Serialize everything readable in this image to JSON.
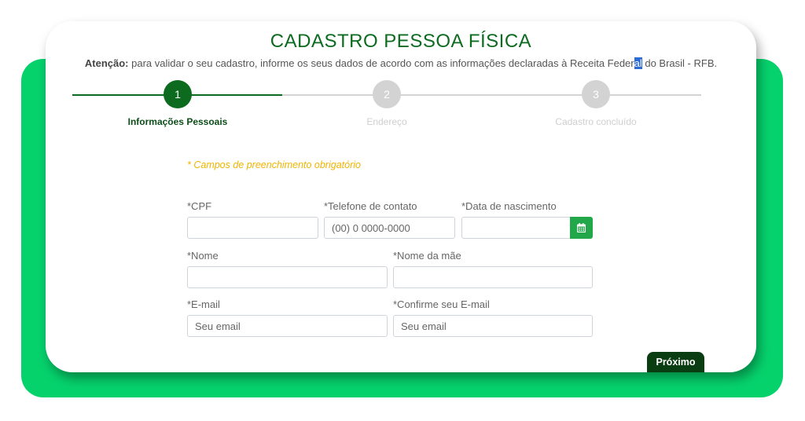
{
  "page": {
    "title": "CADASTRO PESSOA FÍSICA",
    "notice_bold": "Atenção:",
    "notice_text_before": " para validar o seu cadastro, informe os seus dados de acordo com as informações declaradas à Receita Feder",
    "notice_highlight": "al",
    "notice_text_after": " do Brasil - RFB."
  },
  "stepper": {
    "steps": [
      {
        "number": "1",
        "label": "Informações Pessoais",
        "state": "active"
      },
      {
        "number": "2",
        "label": "Endereço",
        "state": "inactive"
      },
      {
        "number": "3",
        "label": "Cadastro concluído",
        "state": "inactive"
      }
    ]
  },
  "form": {
    "required_note": "* Campos de preenchimento obrigatório",
    "cpf": {
      "label": "*CPF",
      "value": "",
      "placeholder": ""
    },
    "telefone": {
      "label": "*Telefone de contato",
      "value": "",
      "placeholder": "(00) 0 0000-0000"
    },
    "nascimento": {
      "label": "*Data de nascimento",
      "value": "",
      "placeholder": ""
    },
    "nome": {
      "label": "*Nome",
      "value": "",
      "placeholder": ""
    },
    "nome_mae": {
      "label": "*Nome da mãe",
      "value": "",
      "placeholder": ""
    },
    "email": {
      "label": "*E-mail",
      "value": "",
      "placeholder": "Seu email"
    },
    "confirma_email": {
      "label": "*Confirme seu E-mail",
      "value": "",
      "placeholder": "Seu email"
    },
    "calendar_icon": "calendar-icon"
  },
  "actions": {
    "next_label": "Próximo"
  },
  "colors": {
    "brand_green": "#06d26c",
    "dark_green": "#0d6b1f",
    "button_dark": "#0b3d13",
    "calendar_green": "#22a84a",
    "note_yellow": "#f0b400"
  }
}
